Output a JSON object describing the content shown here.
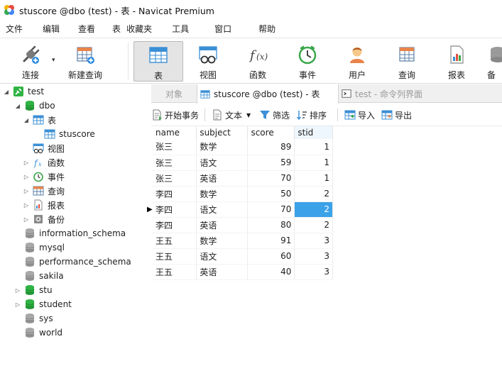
{
  "window": {
    "title": "stuscore @dbo (test) - 表 - Navicat Premium"
  },
  "menu": [
    "文件",
    "编辑",
    "查看",
    "表",
    "收藏夹",
    "工具",
    "窗口",
    "帮助"
  ],
  "toolbar": {
    "connect": "连接",
    "new_query": "新建查询",
    "table": "表",
    "view": "视图",
    "function": "函数",
    "event": "事件",
    "user": "用户",
    "query": "查询",
    "report": "报表",
    "backup_partial": "备"
  },
  "tree": {
    "connection": "test",
    "schema": "dbo",
    "tables_node": "表",
    "table": "stuscore",
    "views": "视图",
    "functions": "函数",
    "events": "事件",
    "queries": "查询",
    "reports": "报表",
    "backups": "备份",
    "databases": [
      "information_schema",
      "mysql",
      "performance_schema",
      "sakila",
      "stu",
      "student",
      "sys",
      "world"
    ]
  },
  "tabs": {
    "objects": "对象",
    "active": "stuscore @dbo (test) - 表",
    "console": "test - 命令列界面"
  },
  "data_toolbar": {
    "begin_transaction": "开始事务",
    "text": "文本",
    "filter": "筛选",
    "sort": "排序",
    "import": "导入",
    "export": "导出"
  },
  "grid": {
    "columns": [
      "name",
      "subject",
      "score",
      "stid"
    ],
    "rows": [
      [
        "张三",
        "数学",
        "89",
        "1"
      ],
      [
        "张三",
        "语文",
        "59",
        "1"
      ],
      [
        "张三",
        "英语",
        "70",
        "1"
      ],
      [
        "李四",
        "数学",
        "50",
        "2"
      ],
      [
        "李四",
        "语文",
        "70",
        "2"
      ],
      [
        "李四",
        "英语",
        "80",
        "2"
      ],
      [
        "王五",
        "数学",
        "91",
        "3"
      ],
      [
        "王五",
        "语文",
        "60",
        "3"
      ],
      [
        "王五",
        "英语",
        "40",
        "3"
      ]
    ],
    "current_row_index": 4,
    "selected_cell": [
      4,
      3
    ]
  },
  "colors": {
    "selection": "#3ba2e8",
    "db_active": "#2fb344",
    "db_inactive": "#9a9a9a",
    "table_icon": "#3b8fd6"
  }
}
